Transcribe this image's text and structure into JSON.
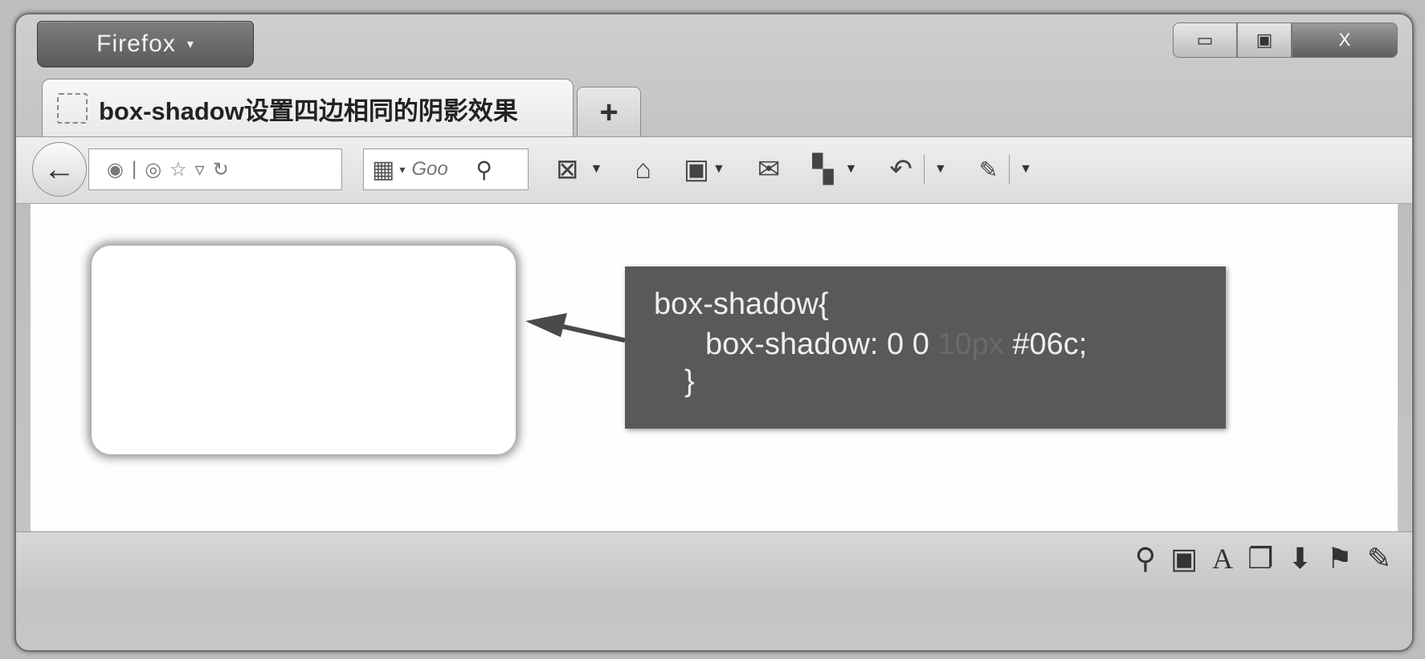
{
  "browser": {
    "app_menu_label": "Firefox",
    "app_menu_arrow": "▾",
    "window_controls": {
      "minimize": "▭",
      "maximize": "▣",
      "close": "X"
    }
  },
  "tab": {
    "title": "box-shadow设置四边相同的阴影效果",
    "new_tab_label": "+"
  },
  "navbar": {
    "back_glyph": "←",
    "url_icons": [
      "globe-icon",
      "separator",
      "site-icon",
      "star-icon",
      "dropdown-icon",
      "reload-icon"
    ],
    "search_engine_icon": "google-icon",
    "search_placeholder": "Goo",
    "search_icon": "magnifier-icon",
    "toolbar_icons": [
      "screenshot-icon",
      "home-icon",
      "bookmarks-icon",
      "mail-icon",
      "addons-icon",
      "history-icon",
      "tools-icon"
    ]
  },
  "content": {
    "code_line1": "box-shadow{",
    "code_line2_prefix": "box-shadow: 0 0 ",
    "code_line2_value": "10px",
    "code_line2_suffix": " #06c;",
    "code_line3": "}"
  },
  "statusbar": {
    "icons": [
      "search-icon",
      "page-icon",
      "font-icon",
      "window-icon",
      "download-icon",
      "flag-icon",
      "brush-icon"
    ]
  }
}
